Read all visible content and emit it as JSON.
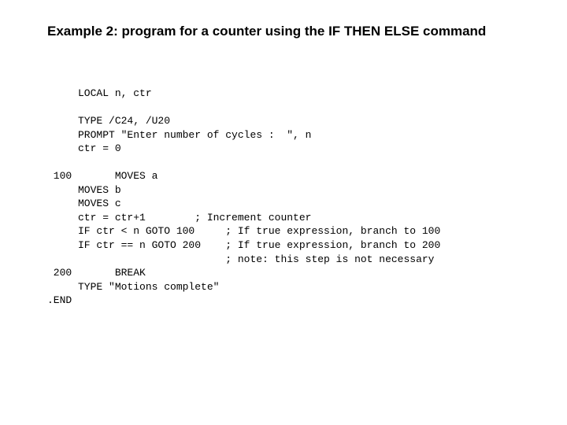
{
  "title": "Example 2:  program for a counter using the IF THEN ELSE command",
  "code": {
    "l01": "     LOCAL n, ctr",
    "l02": "",
    "l03": "     TYPE /C24, /U20",
    "l04": "     PROMPT \"Enter number of cycles :  \", n",
    "l05": "     ctr = 0",
    "l06": "",
    "l07": " 100       MOVES a",
    "l08": "     MOVES b",
    "l09": "     MOVES c",
    "l10": "     ctr = ctr+1        ; Increment counter",
    "l11": "     IF ctr < n GOTO 100     ; If true expression, branch to 100",
    "l12": "     IF ctr == n GOTO 200    ; If true expression, branch to 200",
    "l13": "                             ; note: this step is not necessary",
    "l14": " 200       BREAK",
    "l15": "     TYPE \"Motions complete\"",
    "l16": ".END"
  }
}
